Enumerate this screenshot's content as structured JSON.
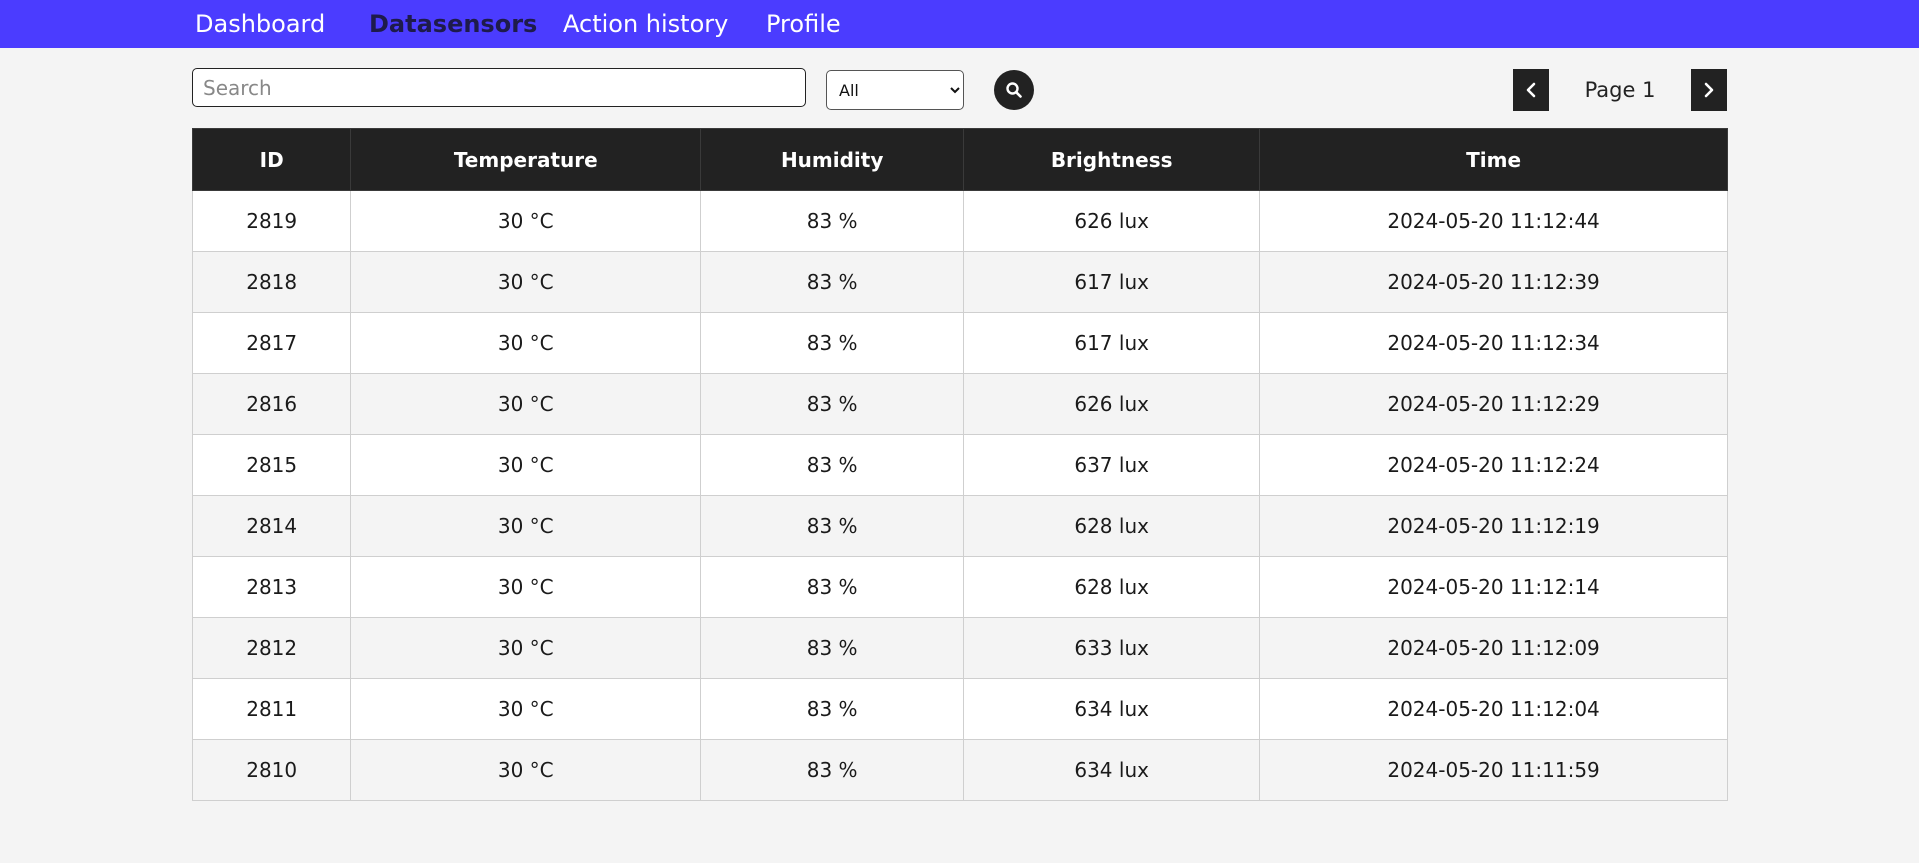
{
  "nav": {
    "items": [
      {
        "label": "Dashboard"
      },
      {
        "label": "Datasensors"
      },
      {
        "label": "Action history"
      },
      {
        "label": "Profile"
      }
    ],
    "active": "Datasensors"
  },
  "colors": {
    "navbar": "#4b3cff",
    "active_nav": "#1e1b4b",
    "table_header": "#222222",
    "row_alt": "#f4f4f4"
  },
  "toolbar": {
    "search_placeholder": "Search",
    "search_value": "",
    "filter_selected": "All",
    "search_icon": "search-icon"
  },
  "pagination": {
    "label": "Page 1",
    "prev_icon": "chevron-left-icon",
    "next_icon": "chevron-right-icon"
  },
  "table": {
    "headers": [
      "ID",
      "Temperature",
      "Humidity",
      "Brightness",
      "Time"
    ],
    "rows": [
      [
        "2819",
        "30 °C",
        "83 %",
        "626 lux",
        "2024-05-20 11:12:44"
      ],
      [
        "2818",
        "30 °C",
        "83 %",
        "617 lux",
        "2024-05-20 11:12:39"
      ],
      [
        "2817",
        "30 °C",
        "83 %",
        "617 lux",
        "2024-05-20 11:12:34"
      ],
      [
        "2816",
        "30 °C",
        "83 %",
        "626 lux",
        "2024-05-20 11:12:29"
      ],
      [
        "2815",
        "30 °C",
        "83 %",
        "637 lux",
        "2024-05-20 11:12:24"
      ],
      [
        "2814",
        "30 °C",
        "83 %",
        "628 lux",
        "2024-05-20 11:12:19"
      ],
      [
        "2813",
        "30 °C",
        "83 %",
        "628 lux",
        "2024-05-20 11:12:14"
      ],
      [
        "2812",
        "30 °C",
        "83 %",
        "633 lux",
        "2024-05-20 11:12:09"
      ],
      [
        "2811",
        "30 °C",
        "83 %",
        "634 lux",
        "2024-05-20 11:12:04"
      ],
      [
        "2810",
        "30 °C",
        "83 %",
        "634 lux",
        "2024-05-20 11:11:59"
      ]
    ]
  }
}
